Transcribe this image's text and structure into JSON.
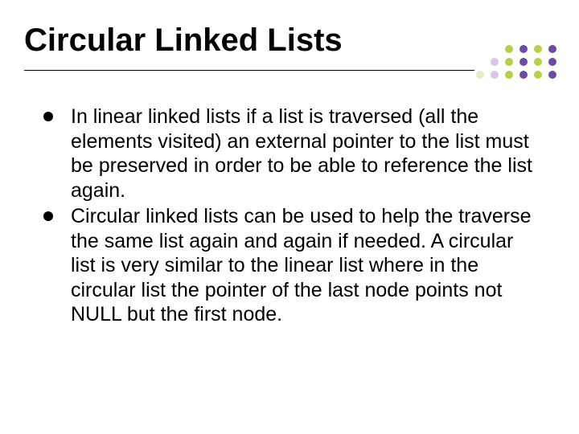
{
  "slide": {
    "title": "Circular Linked Lists",
    "bullets": [
      "In linear linked lists if a list is traversed (all the elements visited) an external pointer to the list must be preserved in order to be able to reference the list again.",
      "Circular linked lists can be used to help the traverse the same list again and again if needed. A circular list is very similar to the linear list where in the circular list the pointer of the last node points not NULL but the first node."
    ]
  },
  "deco": {
    "row1": [
      "#b6d04a",
      "#6c4ba0",
      "#b6d04a",
      "#6c4ba0"
    ],
    "row2": [
      "#d9c6ec",
      "#b6d04a",
      "#6c4ba0",
      "#b6d04a",
      "#6c4ba0"
    ],
    "row3": [
      "#e6eac2",
      "#d9c6ec",
      "#b6d04a",
      "#6c4ba0",
      "#b6d04a",
      "#6c4ba0"
    ]
  }
}
